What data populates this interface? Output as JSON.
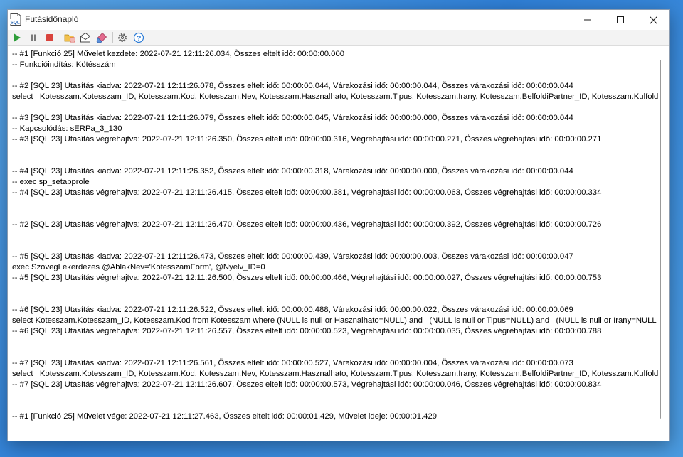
{
  "window": {
    "title": "Futásidőnapló",
    "app_icon_text": "SQL"
  },
  "toolbar": {
    "buttons": [
      {
        "name": "play-icon"
      },
      {
        "name": "pause-icon"
      },
      {
        "name": "stop-icon"
      },
      {
        "name": "open-folder-icon"
      },
      {
        "name": "email-icon"
      },
      {
        "name": "eraser-icon"
      },
      {
        "name": "gear-icon"
      },
      {
        "name": "help-icon"
      }
    ]
  },
  "log": {
    "lines": [
      "-- #1 [Funkció 25] Művelet kezdete: 2022-07-21 12:11:26.034, Összes eltelt idő: 00:00:00.000",
      "-- Funkcióindítás: Kötésszám",
      "",
      "-- #2 [SQL 23] Utasítás kiadva: 2022-07-21 12:11:26.078, Összes eltelt idő: 00:00:00.044, Várakozási idő: 00:00:00.044, Összes várakozási idő: 00:00:00.044",
      "select   Kotesszam.Kotesszam_ID, Kotesszam.Kod, Kotesszam.Nev, Kotesszam.Hasznalhato, Kotesszam.Tipus, Kotesszam.Irany, Kotesszam.BelfoldiPartner_ID, Kotesszam.Kulfoldi",
      "",
      "-- #3 [SQL 23] Utasítás kiadva: 2022-07-21 12:11:26.079, Összes eltelt idő: 00:00:00.045, Várakozási idő: 00:00:00.000, Összes várakozási idő: 00:00:00.044",
      "-- Kapcsolódás: sERPa_3_130",
      "-- #3 [SQL 23] Utasítás végrehajtva: 2022-07-21 12:11:26.350, Összes eltelt idő: 00:00:00.316, Végrehajtási idő: 00:00:00.271, Összes végrehajtási idő: 00:00:00.271",
      "",
      "",
      "-- #4 [SQL 23] Utasítás kiadva: 2022-07-21 12:11:26.352, Összes eltelt idő: 00:00:00.318, Várakozási idő: 00:00:00.000, Összes várakozási idő: 00:00:00.044",
      "-- exec sp_setapprole",
      "-- #4 [SQL 23] Utasítás végrehajtva: 2022-07-21 12:11:26.415, Összes eltelt idő: 00:00:00.381, Végrehajtási idő: 00:00:00.063, Összes végrehajtási idő: 00:00:00.334",
      "",
      "",
      "-- #2 [SQL 23] Utasítás végrehajtva: 2022-07-21 12:11:26.470, Összes eltelt idő: 00:00:00.436, Végrehajtási idő: 00:00:00.392, Összes végrehajtási idő: 00:00:00.726",
      "",
      "",
      "-- #5 [SQL 23] Utasítás kiadva: 2022-07-21 12:11:26.473, Összes eltelt idő: 00:00:00.439, Várakozási idő: 00:00:00.003, Összes várakozási idő: 00:00:00.047",
      "exec SzovegLekerdezes @AblakNev='KotesszamForm', @Nyelv_ID=0",
      "-- #5 [SQL 23] Utasítás végrehajtva: 2022-07-21 12:11:26.500, Összes eltelt idő: 00:00:00.466, Végrehajtási idő: 00:00:00.027, Összes végrehajtási idő: 00:00:00.753",
      "",
      "",
      "-- #6 [SQL 23] Utasítás kiadva: 2022-07-21 12:11:26.522, Összes eltelt idő: 00:00:00.488, Várakozási idő: 00:00:00.022, Összes várakozási idő: 00:00:00.069",
      "select Kotesszam.Kotesszam_ID, Kotesszam.Kod from Kotesszam where (NULL is null or Hasznalhato=NULL) and   (NULL is null or Tipus=NULL) and   (NULL is null or Irany=NULL",
      "-- #6 [SQL 23] Utasítás végrehajtva: 2022-07-21 12:11:26.557, Összes eltelt idő: 00:00:00.523, Végrehajtási idő: 00:00:00.035, Összes végrehajtási idő: 00:00:00.788",
      "",
      "",
      "-- #7 [SQL 23] Utasítás kiadva: 2022-07-21 12:11:26.561, Összes eltelt idő: 00:00:00.527, Várakozási idő: 00:00:00.004, Összes várakozási idő: 00:00:00.073",
      "select   Kotesszam.Kotesszam_ID, Kotesszam.Kod, Kotesszam.Nev, Kotesszam.Hasznalhato, Kotesszam.Tipus, Kotesszam.Irany, Kotesszam.BelfoldiPartner_ID, Kotesszam.Kulfoldi",
      "-- #7 [SQL 23] Utasítás végrehajtva: 2022-07-21 12:11:26.607, Összes eltelt idő: 00:00:00.573, Végrehajtási idő: 00:00:00.046, Összes végrehajtási idő: 00:00:00.834",
      "",
      "",
      "-- #1 [Funkció 25] Művelet vége: 2022-07-21 12:11:27.463, Összes eltelt idő: 00:00:01.429, Művelet ideje: 00:00:01.429"
    ]
  },
  "colors": {
    "play": "#2e9e3a",
    "pause": "#7a7a7a",
    "stop": "#d9443d",
    "help": "#2b7bd6"
  }
}
